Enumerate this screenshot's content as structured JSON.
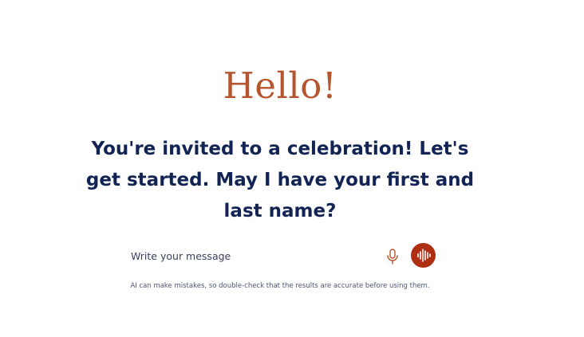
{
  "greeting": "Hello!",
  "prompt": "You're invited to a celebration! Let's get started. May I have your first and last name?",
  "composer": {
    "placeholder": "Write your message",
    "value": "",
    "mic_icon": "microphone-icon",
    "voice_icon": "sound-wave-icon"
  },
  "disclaimer": "AI can make mistakes, so double-check that the results are accurate before using them.",
  "colors": {
    "accent": "#b4552f",
    "voice_button": "#ae2f12",
    "heading": "#122454"
  }
}
